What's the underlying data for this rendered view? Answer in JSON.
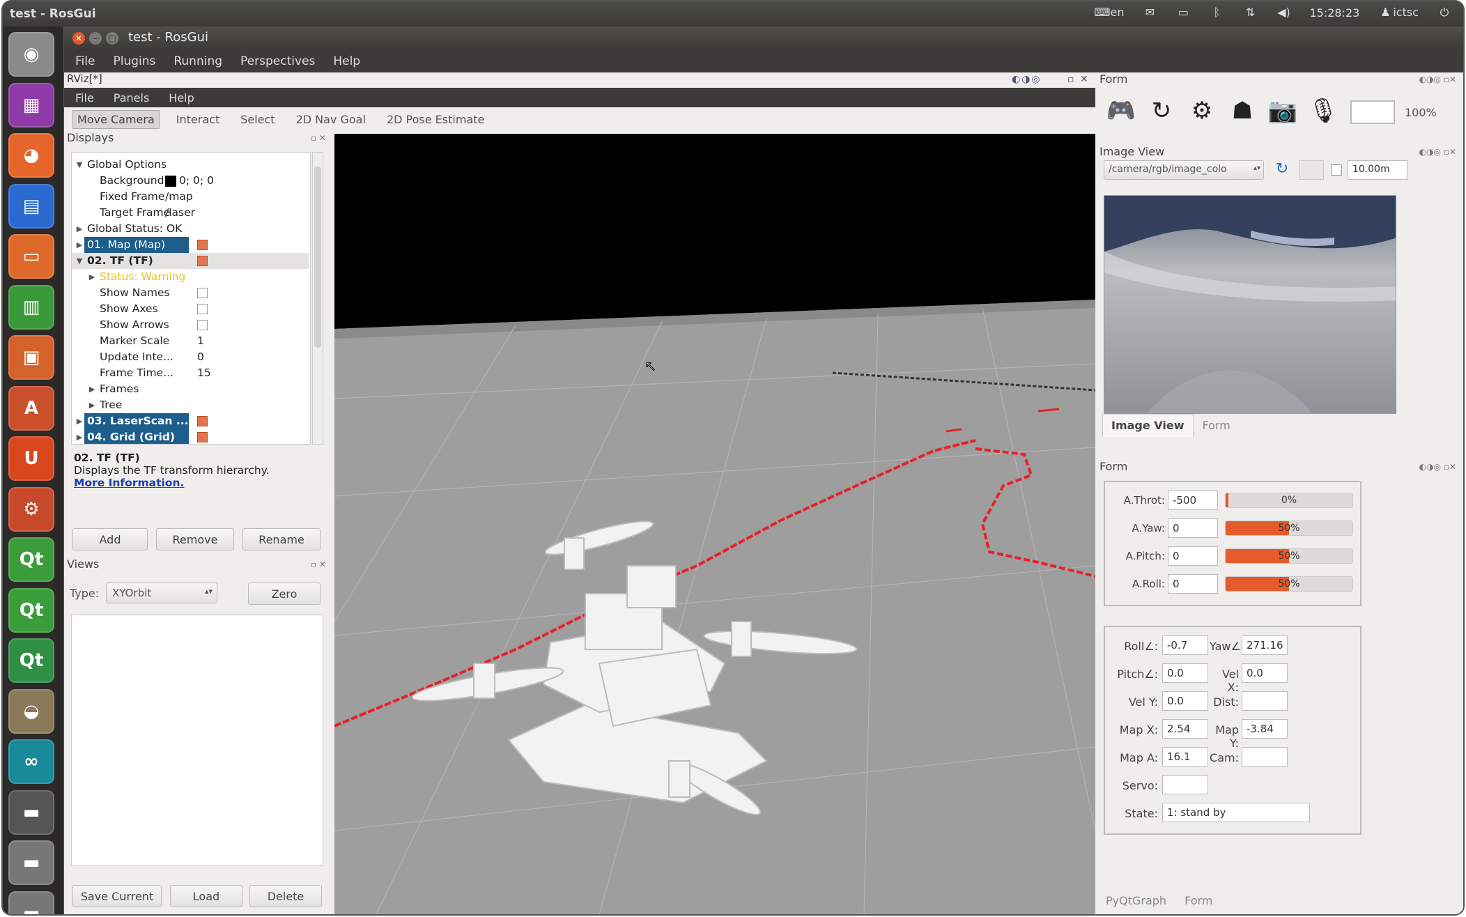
{
  "topbar": {
    "title": "test - RosGui",
    "keyboard_label": "en",
    "time": "15:28:23",
    "user": "ictsc"
  },
  "launcher": [
    {
      "name": "ubuntu-dash-icon",
      "glyph": "◉",
      "color": "#8a8a8a"
    },
    {
      "name": "workspace-icon",
      "glyph": "▦",
      "color": "#8e3aa8"
    },
    {
      "name": "firefox-icon",
      "glyph": "◕",
      "color": "#e6652a"
    },
    {
      "name": "writer-icon",
      "glyph": "▤",
      "color": "#2a6ad1"
    },
    {
      "name": "files-icon",
      "glyph": "▭",
      "color": "#dd6a2c"
    },
    {
      "name": "calc-icon",
      "glyph": "▥",
      "color": "#3a9a3a"
    },
    {
      "name": "impress-icon",
      "glyph": "▣",
      "color": "#d4622a"
    },
    {
      "name": "software-center-icon",
      "glyph": "A",
      "color": "#c9502b"
    },
    {
      "name": "ubuntu-one-icon",
      "glyph": "U",
      "color": "#d9471f"
    },
    {
      "name": "settings-icon",
      "glyph": "⚙",
      "color": "#c84a2a"
    },
    {
      "name": "qt-creator-icon",
      "glyph": "Qt",
      "color": "#3b9c3b"
    },
    {
      "name": "qt-designer-icon",
      "glyph": "Qt",
      "color": "#3b9c3b"
    },
    {
      "name": "qt-linguist-icon",
      "glyph": "Qt",
      "color": "#2f8f45"
    },
    {
      "name": "gimp-icon",
      "glyph": "◒",
      "color": "#8a7a5a"
    },
    {
      "name": "arduino-icon",
      "glyph": "∞",
      "color": "#1a8a9a"
    },
    {
      "name": "terminal-icon",
      "glyph": "▬",
      "color": "#555555"
    },
    {
      "name": "storage-icon",
      "glyph": "▬",
      "color": "#777777"
    },
    {
      "name": "storage2-icon",
      "glyph": "▬",
      "color": "#777777"
    }
  ],
  "window": {
    "title": "test - RosGui",
    "menu": [
      "File",
      "Plugins",
      "Running",
      "Perspectives",
      "Help"
    ]
  },
  "rviz": {
    "title": "RViz[*]",
    "menu": [
      "File",
      "Panels",
      "Help"
    ],
    "tools": [
      "Move Camera",
      "Interact",
      "Select",
      "2D Nav Goal",
      "2D Pose Estimate"
    ],
    "displays_title": "Displays",
    "tree": {
      "global_options": "Global Options",
      "background_label": "Background...",
      "background_value": "0; 0; 0",
      "fixed_frame_label": "Fixed Frame",
      "fixed_frame_value": "/map",
      "target_frame_label": "Target Frame",
      "target_frame_value": "/laser",
      "global_status": "Global Status: OK",
      "map": "01. Map (Map)",
      "tf": "02. TF (TF)",
      "status_warning": "Status: Warning",
      "show_names": "Show Names",
      "show_axes": "Show Axes",
      "show_arrows": "Show Arrows",
      "marker_scale_label": "Marker Scale",
      "marker_scale_value": "1",
      "update_interval_label": "Update Inte...",
      "update_interval_value": "0",
      "frame_timeout_label": "Frame Time...",
      "frame_timeout_value": "15",
      "frames": "Frames",
      "tree": "Tree",
      "laserscan": "03. LaserScan ...",
      "grid": "04. Grid (Grid)"
    },
    "desc_title": "02. TF (TF)",
    "desc_text": "Displays the TF transform hierarchy.",
    "desc_link": "More Information.",
    "add": "Add",
    "remove": "Remove",
    "rename": "Rename",
    "views_title": "Views",
    "type_label": "Type:",
    "type_value": "XYOrbit",
    "zero": "Zero",
    "save_current": "Save Current",
    "load": "Load",
    "delete": "Delete"
  },
  "form_top": {
    "title": "Form",
    "zoom": "100%"
  },
  "image_view": {
    "title": "Image View",
    "topic": "/camera/rgb/image_colo",
    "size": "10.00m",
    "tabs": [
      "Image View",
      "Form"
    ]
  },
  "form": {
    "title": "Form",
    "sliders": [
      {
        "label": "A.Throt:",
        "value": "-500",
        "fill": 0.02,
        "pct": "0%"
      },
      {
        "label": "A.Yaw:",
        "value": "0",
        "fill": 0.5,
        "pct": "50%"
      },
      {
        "label": "A.Pitch:",
        "value": "0",
        "fill": 0.5,
        "pct": "50%"
      },
      {
        "label": "A.Roll:",
        "value": "0",
        "fill": 0.5,
        "pct": "50%"
      }
    ],
    "roll_label": "Roll∠:",
    "roll": "-0.7",
    "yaw_label": "Yaw∠:",
    "yaw": "271.16",
    "pitch_label": "Pitch∠:",
    "pitch": "0.0",
    "velx_label": "Vel X:",
    "velx": "0.0",
    "vely_label": "Vel Y:",
    "vely": "0.0",
    "dist_label": "Dist:",
    "dist": "",
    "mapx_label": "Map X:",
    "mapx": "2.54",
    "mapy_label": "Map Y:",
    "mapy": "-3.84",
    "mapa_label": "Map A:",
    "mapa": "16.1",
    "cam_label": "Cam:",
    "cam": "",
    "servo_label": "Servo:",
    "servo": "",
    "state_label": "State:",
    "state": "1: stand by",
    "bottom_tabs": [
      "PyQtGraph",
      "Form"
    ]
  },
  "colors": {
    "accent": "#e45b2d",
    "selection": "#1d5e8c",
    "laser": "#e8202a"
  }
}
